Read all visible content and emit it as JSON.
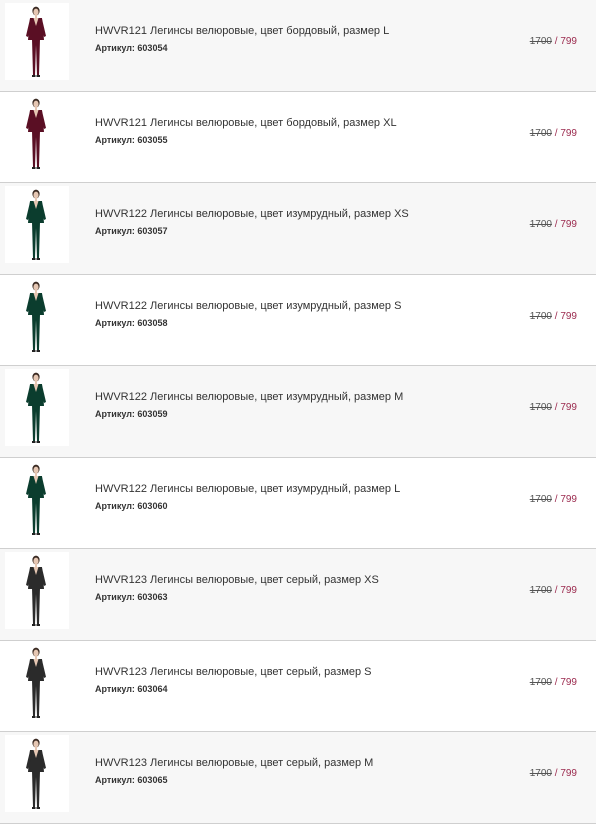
{
  "colors": {
    "burgundy": "#5a0f24",
    "emerald": "#0b3d2e",
    "grey": "#2b2b2b",
    "price_accent": "#9b2a4e"
  },
  "items": [
    {
      "title": "HWVR121 Легинсы велюровые, цвет бордовый, размер L",
      "sku": "Артикул: 603054",
      "old_price": "1700",
      "sep": " / ",
      "new_price": "799",
      "color": "burgundy",
      "image_icon": "model-photo-burgundy"
    },
    {
      "title": "HWVR121 Легинсы велюровые, цвет бордовый, размер XL",
      "sku": "Артикул: 603055",
      "old_price": "1700",
      "sep": " / ",
      "new_price": "799",
      "color": "burgundy",
      "image_icon": "model-photo-burgundy"
    },
    {
      "title": "HWVR122 Легинсы велюровые, цвет изумрудный, размер XS",
      "sku": "Артикул: 603057",
      "old_price": "1700",
      "sep": " / ",
      "new_price": "799",
      "color": "emerald",
      "image_icon": "model-photo-emerald"
    },
    {
      "title": "HWVR122 Легинсы велюровые, цвет изумрудный, размер S",
      "sku": "Артикул: 603058",
      "old_price": "1700",
      "sep": " / ",
      "new_price": "799",
      "color": "emerald",
      "image_icon": "model-photo-emerald"
    },
    {
      "title": "HWVR122 Легинсы велюровые, цвет изумрудный, размер M",
      "sku": "Артикул: 603059",
      "old_price": "1700",
      "sep": " / ",
      "new_price": "799",
      "color": "emerald",
      "image_icon": "model-photo-emerald"
    },
    {
      "title": "HWVR122 Легинсы велюровые, цвет изумрудный, размер L",
      "sku": "Артикул: 603060",
      "old_price": "1700",
      "sep": " / ",
      "new_price": "799",
      "color": "emerald",
      "image_icon": "model-photo-emerald"
    },
    {
      "title": "HWVR123 Легинсы велюровые, цвет серый, размер XS",
      "sku": "Артикул: 603063",
      "old_price": "1700",
      "sep": " / ",
      "new_price": "799",
      "color": "grey",
      "image_icon": "model-photo-grey"
    },
    {
      "title": "HWVR123 Легинсы велюровые, цвет серый, размер S",
      "sku": "Артикул: 603064",
      "old_price": "1700",
      "sep": " / ",
      "new_price": "799",
      "color": "grey",
      "image_icon": "model-photo-grey"
    },
    {
      "title": "HWVR123 Легинсы велюровые, цвет серый, размер M",
      "sku": "Артикул: 603065",
      "old_price": "1700",
      "sep": " / ",
      "new_price": "799",
      "color": "grey",
      "image_icon": "model-photo-grey"
    }
  ]
}
